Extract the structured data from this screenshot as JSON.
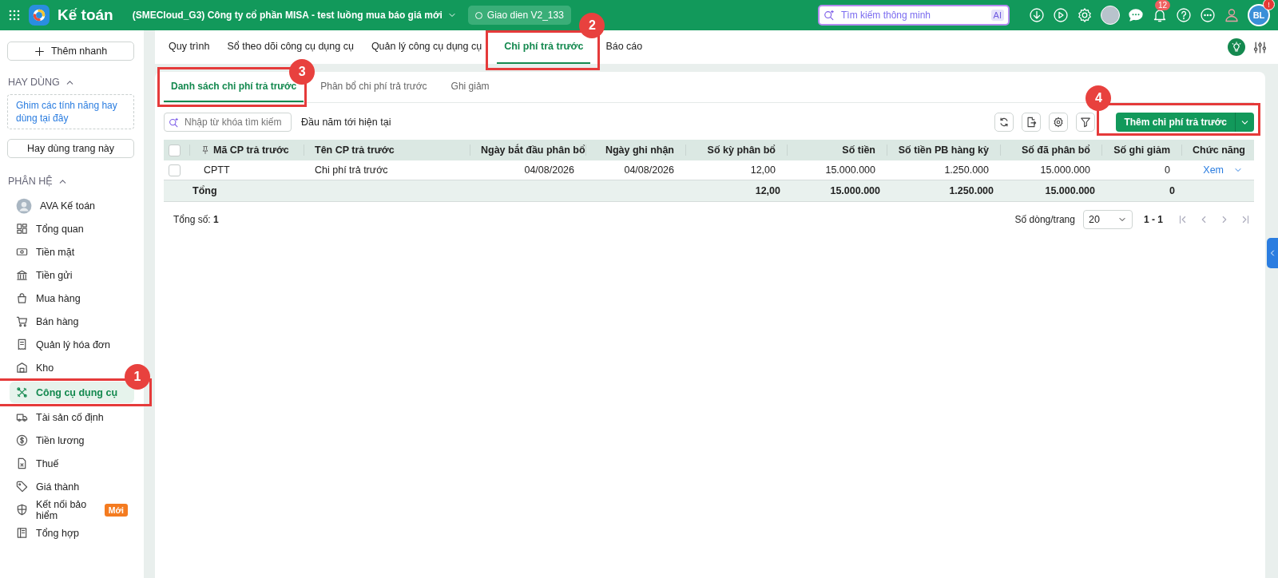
{
  "topbar": {
    "app_name": "Kế toán",
    "company": "(SMECloud_G3) Công ty cổ phần MISA - test luồng mua báo giá mới",
    "version": "Giao dien V2_133",
    "search": {
      "placeholder": "Tìm kiếm thông minh",
      "ai_badge": "AI"
    },
    "notifications": "12",
    "user_initials": "BL",
    "user_alert": "!"
  },
  "sidebar": {
    "quick_add": "Thêm nhanh",
    "favorites": {
      "title": "HAY DÙNG",
      "expanded": true,
      "hint": "Ghim các tính năng hay dùng tại đây",
      "pin_button": "Hay dùng trang này"
    },
    "modules": {
      "title": "PHÂN HỆ",
      "expanded": true,
      "items": [
        {
          "label": "AVA Kế toán",
          "selected": false
        },
        {
          "label": "Tổng quan",
          "selected": false
        },
        {
          "label": "Tiền mặt",
          "selected": false
        },
        {
          "label": "Tiền gửi",
          "selected": false
        },
        {
          "label": "Mua hàng",
          "selected": false
        },
        {
          "label": "Bán hàng",
          "selected": false
        },
        {
          "label": "Quản lý hóa đơn",
          "selected": false
        },
        {
          "label": "Kho",
          "selected": false
        },
        {
          "label": "Công cụ dụng cụ",
          "selected": true,
          "callout": "1"
        },
        {
          "label": "Tài sản cố định",
          "selected": false
        },
        {
          "label": "Tiền lương",
          "selected": false
        },
        {
          "label": "Thuế",
          "selected": false
        },
        {
          "label": "Giá thành",
          "selected": false
        },
        {
          "label": "Kết nối bảo hiểm",
          "selected": false,
          "badge": "Mới"
        },
        {
          "label": "Tổng hợp",
          "selected": false
        }
      ]
    }
  },
  "nav_tabs": [
    {
      "label": "Quy trình",
      "selected": false
    },
    {
      "label": "Sổ theo dõi công cụ dụng cụ",
      "selected": false
    },
    {
      "label": "Quản lý công cụ dụng cụ",
      "selected": false
    },
    {
      "label": "Chi phí trả trước",
      "selected": true,
      "callout": "2"
    },
    {
      "label": "Báo cáo",
      "selected": false
    }
  ],
  "sub_tabs": [
    {
      "label": "Danh sách chi phí trả trước",
      "selected": true,
      "callout": "3"
    },
    {
      "label": "Phân bổ chi phí trả trước",
      "selected": false
    },
    {
      "label": "Ghi giảm",
      "selected": false
    }
  ],
  "toolbar": {
    "search": {
      "placeholder": "Nhập từ khóa tìm kiếm"
    },
    "period": "Đầu năm tới hiện tại",
    "add_button": {
      "label": "Thêm chi phí trả trước",
      "callout": "4"
    }
  },
  "table": {
    "all_selected": false,
    "columns": [
      {
        "label": "Mã CP trả trước"
      },
      {
        "label": "Tên CP trả trước"
      },
      {
        "label": "Ngày bắt đầu phân bổ"
      },
      {
        "label": "Ngày ghi nhận"
      },
      {
        "label": "Số kỳ phân bổ"
      },
      {
        "label": "Số tiền"
      },
      {
        "label": "Số tiền PB hàng kỳ"
      },
      {
        "label": "Số đã phân bổ"
      },
      {
        "label": "Số ghi giảm"
      },
      {
        "label": "Chức năng"
      }
    ],
    "rows": [
      {
        "checked": false,
        "cells": [
          "CPTT",
          "Chi phí trả trước",
          "04/08/2026",
          "04/08/2026",
          "12,00",
          "15.000.000",
          "1.250.000",
          "15.000.000",
          "0"
        ],
        "action": "Xem"
      }
    ],
    "total": {
      "label": "Tổng",
      "values": [
        "12,00",
        "15.000.000",
        "1.250.000",
        "15.000.000",
        "0"
      ]
    }
  },
  "footer": {
    "total_count": "Tổng số: **1**",
    "page_size_label": "Số dòng/trang",
    "page_size": "20",
    "range": "1 - 1"
  }
}
